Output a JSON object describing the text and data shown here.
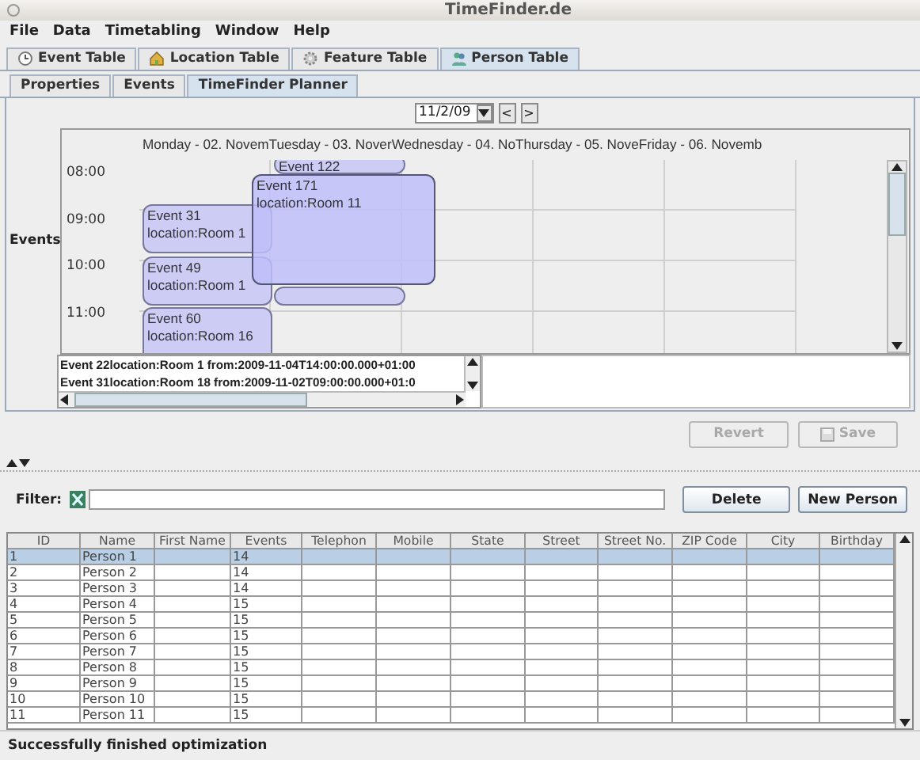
{
  "window": {
    "title": "TimeFinder.de"
  },
  "menu": [
    "File",
    "Data",
    "Timetabling",
    "Window",
    "Help"
  ],
  "tabs": [
    {
      "label": "Event Table",
      "selected": false,
      "kind": "clock"
    },
    {
      "label": "Location Table",
      "selected": false,
      "kind": "house"
    },
    {
      "label": "Feature Table",
      "selected": false,
      "kind": "gear"
    },
    {
      "label": "Person Table",
      "selected": true,
      "kind": "people"
    }
  ],
  "subtabs": [
    {
      "label": "Properties",
      "selected": false
    },
    {
      "label": "Events",
      "selected": false
    },
    {
      "label": "TimeFinder Planner",
      "selected": true
    }
  ],
  "planner": {
    "date": "11/2/09",
    "prev": "<",
    "next": ">",
    "row_label": "Events",
    "days": [
      "Monday - 02. Novem",
      "Tuesday - 03. Nover",
      "Wednesday - 04. No",
      "Thursday - 05. Nove",
      "Friday - 06. Novemb"
    ],
    "hours": [
      "08:00",
      "09:00",
      "10:00",
      "11:00"
    ],
    "events": [
      {
        "kind": "event",
        "title": "Event 122"
      },
      {
        "kind": "shadow"
      },
      {
        "kind": "event",
        "title": "Event 31",
        "location": "location:Room 1"
      },
      {
        "kind": "event",
        "title": "Event 49",
        "location": "location:Room 1"
      },
      {
        "kind": "event",
        "title": "Event 60",
        "location": "location:Room 16"
      },
      {
        "kind": "dragged",
        "title": "Event 171",
        "location": "location:Room 11"
      }
    ],
    "list": [
      "Event 22location:Room 1 from:2009-11-04T14:00:00.000+01:00",
      "Event 31location:Room 18 from:2009-11-02T09:00:00.000+01:0"
    ]
  },
  "form_buttons": [
    {
      "label": "Revert",
      "disabled": true,
      "kind": "plain"
    },
    {
      "label": "Save",
      "disabled": true,
      "kind": "save"
    }
  ],
  "filter": {
    "label": "Filter:"
  },
  "table_buttons": [
    {
      "label": "Delete",
      "disabled": false
    },
    {
      "label": "New Person",
      "disabled": false
    }
  ],
  "table": {
    "columns": [
      "ID",
      "Name",
      "First Name",
      "Events",
      "Telephon",
      "Mobile",
      "State",
      "Street",
      "Street No.",
      "ZIP Code",
      "City",
      "Birthday"
    ],
    "rows": [
      {
        "id": "1",
        "name": "Person 1",
        "events": "14",
        "selected": true
      },
      {
        "id": "2",
        "name": "Person 2",
        "events": "14",
        "selected": false
      },
      {
        "id": "3",
        "name": "Person 3",
        "events": "14",
        "selected": false
      },
      {
        "id": "4",
        "name": "Person 4",
        "events": "15",
        "selected": false
      },
      {
        "id": "5",
        "name": "Person 5",
        "events": "15",
        "selected": false
      },
      {
        "id": "6",
        "name": "Person 6",
        "events": "15",
        "selected": false
      },
      {
        "id": "7",
        "name": "Person 7",
        "events": "15",
        "selected": false
      },
      {
        "id": "8",
        "name": "Person 8",
        "events": "15",
        "selected": false
      },
      {
        "id": "9",
        "name": "Person 9",
        "events": "15",
        "selected": false
      },
      {
        "id": "10",
        "name": "Person 10",
        "events": "15",
        "selected": false
      },
      {
        "id": "11",
        "name": "Person 11",
        "events": "15",
        "selected": false
      }
    ]
  },
  "status_bar": "Successfully finished optimization"
}
